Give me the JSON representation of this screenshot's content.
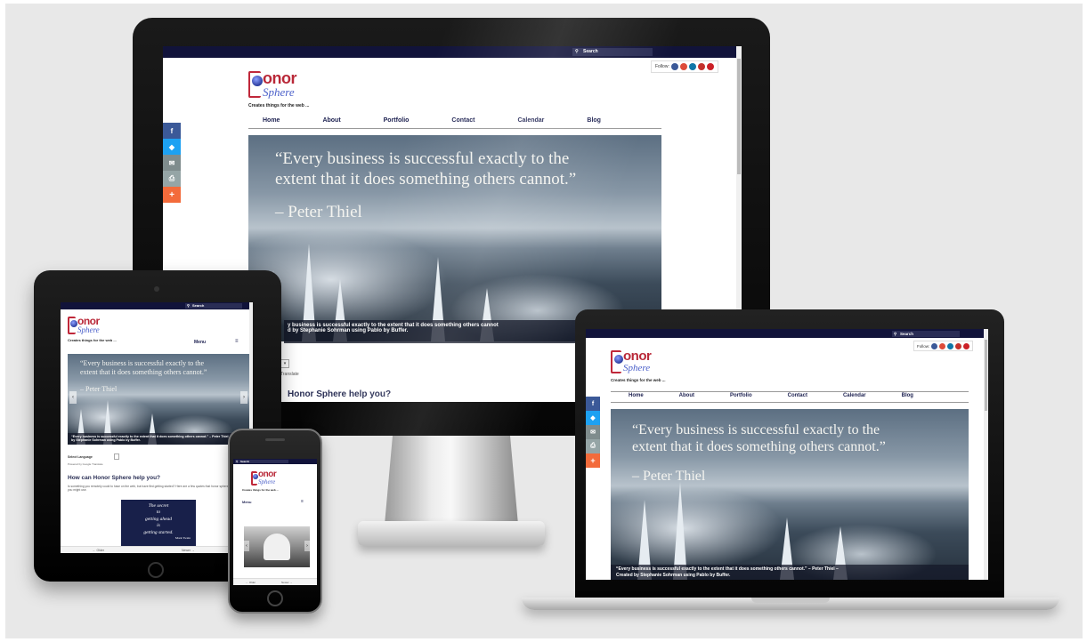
{
  "site": {
    "search_label": "Search",
    "logo_top": "onor",
    "logo_bottom": "Sphere",
    "tagline": "Creates things for the web ...",
    "follow_label": "Follow:",
    "nav": [
      "Home",
      "About",
      "Portfolio",
      "Contact",
      "Calendar",
      "Blog"
    ],
    "menu_label": "Menu",
    "menu_icon": "hamburger-icon",
    "quote_line1": "“Every business is successful exactly to the",
    "quote_line2": "extent that it does something others cannot.”",
    "quote_author": "– Peter Thiel",
    "caption_line1": "“Every business is successful exactly to the extent that it does something others cannot.” – Peter Thiel –",
    "caption_line2": "Created by Stephanie Sohrman using Pablo by Buffer.",
    "desktop_caption_line1": "y business is successful exactly to the extent that it does something others cannot",
    "desktop_caption_line2": "d by Stephanie Sohrman using Pablo by Buffer.",
    "translate_label": "Translate",
    "help_heading": "How can Honor Sphere help you?",
    "desktop_help_heading": "Honor Sphere help you?",
    "select_language": "Select Language",
    "select_language_sub": "Powered by Google Translate",
    "help_body": "Is something you remotely could to have on the web, but have fled getting started? Here are a few quotes that honor sphere to help you might use.",
    "card_line1": "The secret",
    "card_line2": "to",
    "card_line3": "getting ahead",
    "card_line4": "is",
    "card_line5": "getting started.",
    "card_author": "Mark Twain",
    "tablet_quote1": "“Every business is successful exactly to the",
    "tablet_quote2": "extent that it does something others cannot.”",
    "tablet_author": "– Peter Thiel",
    "tablet_caption": "“Every business is successful exactly to the extent that it does something others cannot.” – Peter Thiel – Created by Stephanie Sohrman using Pablo by Buffer.",
    "footer_left": "Older",
    "footer_right": "Newer",
    "footer_left_icon": "arrow-left-icon",
    "footer_right_icon": "arrow-right-icon"
  },
  "colors": {
    "topbar": "#11133a",
    "logo_red": "#b92838",
    "logo_blue": "#4a5fc9",
    "facebook": "#3b5998",
    "twitter": "#1da1f2",
    "email": "#7f8c8d",
    "printer": "#95a5a6",
    "more": "#f36b3b"
  },
  "icons": {
    "share": [
      "facebook-icon",
      "twitter-icon",
      "email-icon",
      "print-icon",
      "plus-icon"
    ],
    "follow": [
      "facebook-icon",
      "google-plus-icon",
      "linkedin-icon",
      "youtube-icon",
      "pinterest-icon"
    ]
  }
}
